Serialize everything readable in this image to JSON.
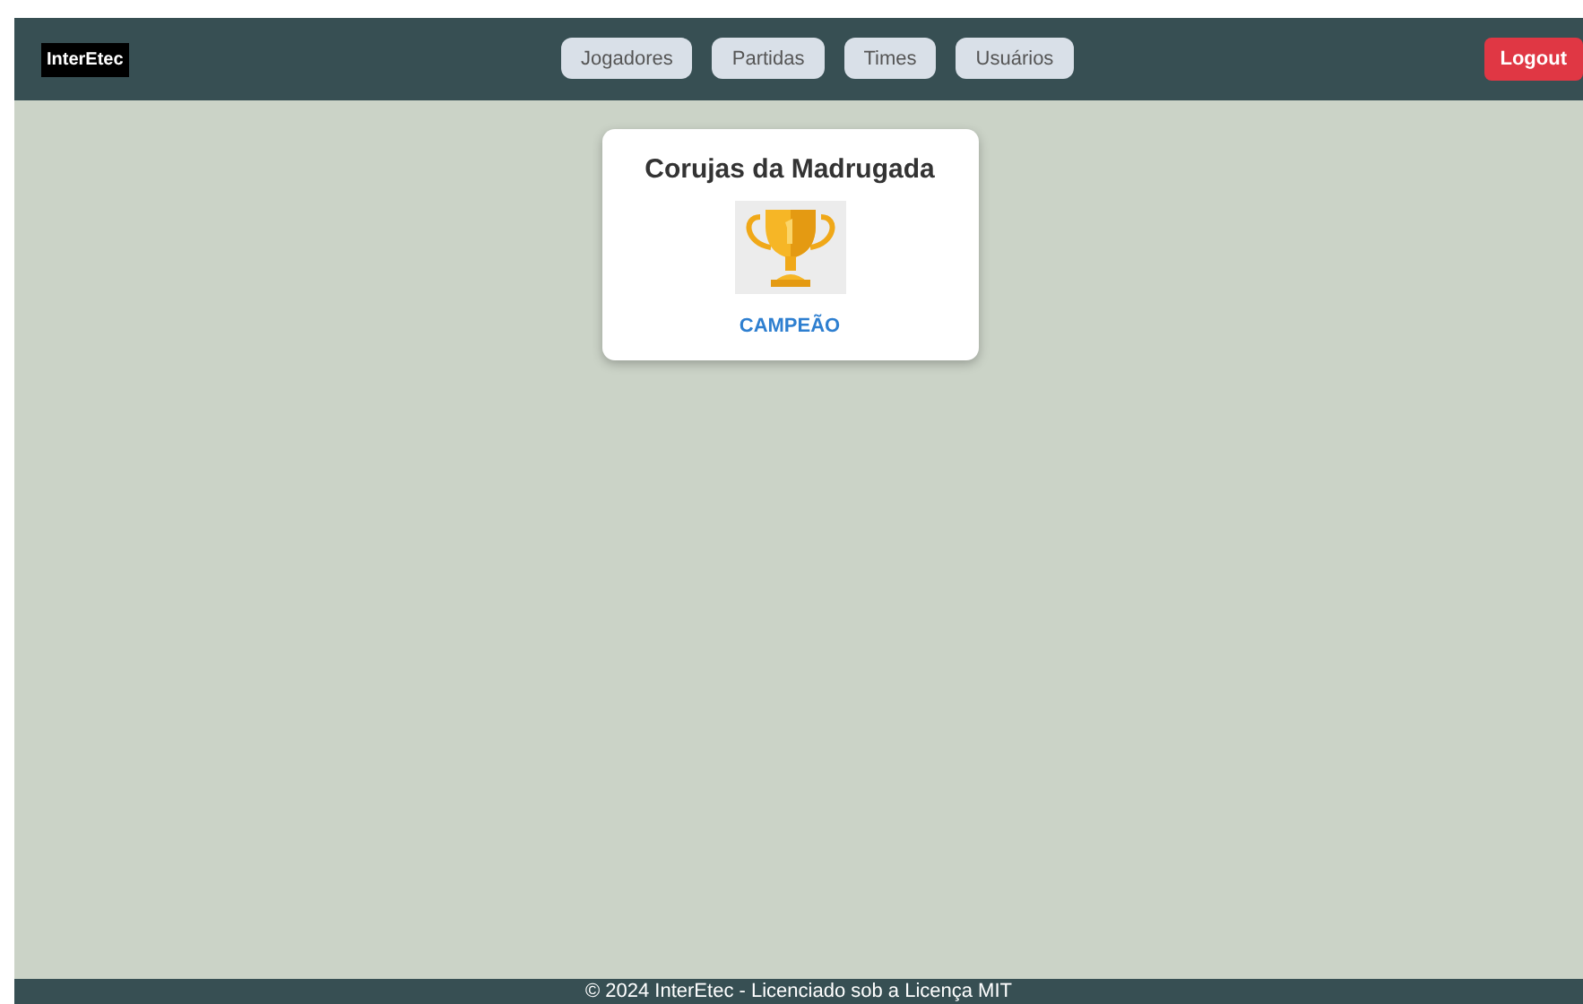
{
  "header": {
    "logo": "InterEtec",
    "nav": [
      {
        "label": "Jogadores"
      },
      {
        "label": "Partidas"
      },
      {
        "label": "Times"
      },
      {
        "label": "Usuários"
      }
    ],
    "logout": "Logout"
  },
  "cards": [
    {
      "team": "Corujas da Madrugada",
      "status": "CAMPEÃO"
    }
  ],
  "footer": "© 2024 InterEtec - Licenciado sob a Licença MIT"
}
